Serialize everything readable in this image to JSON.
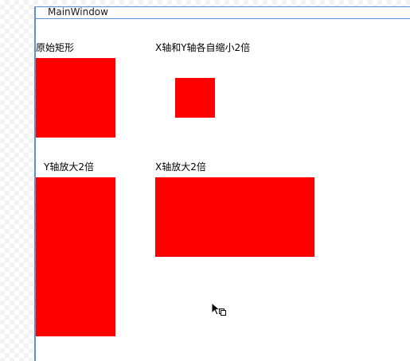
{
  "window": {
    "title": "MainWindow"
  },
  "accent_color": "#5b8fd6",
  "rect_color": "#ff0000",
  "panels": [
    {
      "id": "original",
      "label": "原始矩形"
    },
    {
      "id": "shrink-both",
      "label": "X轴和Y轴各自缩小2倍"
    },
    {
      "id": "scale-y",
      "label": "Y轴放大2倍"
    },
    {
      "id": "scale-x",
      "label": "X轴放大2倍"
    }
  ],
  "cursor": {
    "icon": "arrow-copy-cursor-icon"
  }
}
